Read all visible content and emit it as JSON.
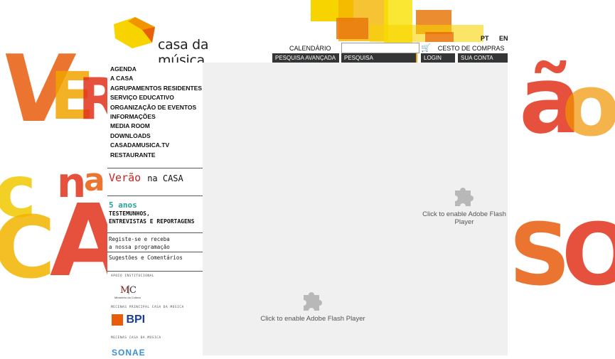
{
  "brand": {
    "name": "casa da música",
    "colors": {
      "yellow": "#f7d400",
      "orange": "#f29400",
      "red": "#e22b1c",
      "dark": "#333537"
    }
  },
  "header": {
    "languages": [
      "PT",
      "EN"
    ],
    "calendar_label": "CALENDÁRIO",
    "search_value": "",
    "cart_label": "CESTO DE COMPRAS",
    "cart_icon": "cart-icon",
    "buttons": {
      "advanced_search": "PESQUISA AVANÇADA",
      "search": "PESQUISA",
      "login": "LOGIN",
      "account": "SUA CONTA"
    }
  },
  "nav": {
    "items": [
      "AGENDA",
      "A CASA",
      "AGRUPAMENTOS RESIDENTES",
      "SERVIÇO EDUCATIVO",
      "ORGANIZAÇÃO DE EVENTOS",
      "INFORMAÇÕES",
      "MEDIA ROOM",
      "DOWNLOADS",
      "CASADAMUSICA.TV",
      "RESTAURANTE"
    ]
  },
  "promos": {
    "verao_a": "Verão",
    "verao_b": "na CASA",
    "anos_title": "5 anos",
    "anos_line1": "TESTEMUNHOS,",
    "anos_line2": "ENTREVISTAS E REPORTAGENS",
    "register_line1": "Registe-se e receba",
    "register_line2": "a nossa programação",
    "suggestions": "Sugestões e Comentários"
  },
  "sponsors": {
    "apoio": "APOIO INSTITUCIONAL",
    "mc_caption": "Ministério da Cultura",
    "mecenas_principal": "MECENAS PRINCIPAL CASA DA MÚSICA",
    "bpi": "BPI",
    "mecenas": "MECENAS CASA DA MÚSICA",
    "sonae": "SONAE"
  },
  "flash": {
    "side_text": "Click to enable Adobe Flash Player",
    "main_text": "Click to enable Adobe Flash Player",
    "icon": "puzzle-icon"
  },
  "background": {
    "left_letters": "VER na CA",
    "right_letters": "ão SO"
  }
}
